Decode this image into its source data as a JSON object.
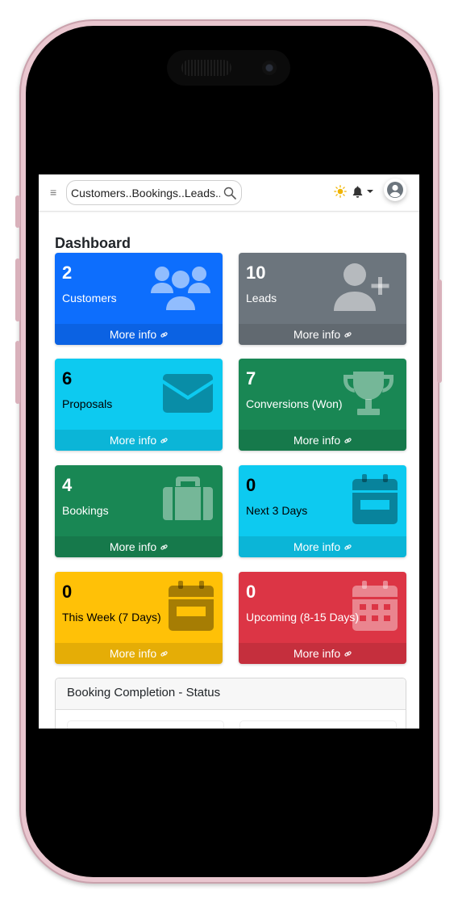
{
  "header": {
    "search_placeholder": "Customers..Bookings..Leads.."
  },
  "page": {
    "title": "Dashboard"
  },
  "cards": [
    {
      "count": "2",
      "label": "Customers",
      "footer": "More info",
      "color": "#0d6efd",
      "icon": "users-icon"
    },
    {
      "count": "10",
      "label": "Leads",
      "footer": "More info",
      "color": "#6c757d",
      "icon": "user-plus-icon"
    },
    {
      "count": "6",
      "label": "Proposals",
      "footer": "More info",
      "color": "#0dcaf0",
      "icon": "envelope-icon"
    },
    {
      "count": "7",
      "label": "Conversions (Won)",
      "footer": "More info",
      "color": "#198754",
      "icon": "trophy-icon"
    },
    {
      "count": "4",
      "label": "Bookings",
      "footer": "More info",
      "color": "#198754",
      "icon": "suitcase-icon"
    },
    {
      "count": "0",
      "label": "Next 3 Days",
      "footer": "More info",
      "color": "#0dcaf0",
      "icon": "calendar-icon"
    },
    {
      "count": "0",
      "label": "This Week (7 Days)",
      "footer": "More info",
      "color": "#ffc107",
      "icon": "calendar-week-icon"
    },
    {
      "count": "0",
      "label": "Upcoming (8-15 Days)",
      "footer": "More info",
      "color": "#dc3545",
      "icon": "calendar-grid-icon"
    }
  ],
  "status": {
    "title": "Booking Completion - Status"
  }
}
